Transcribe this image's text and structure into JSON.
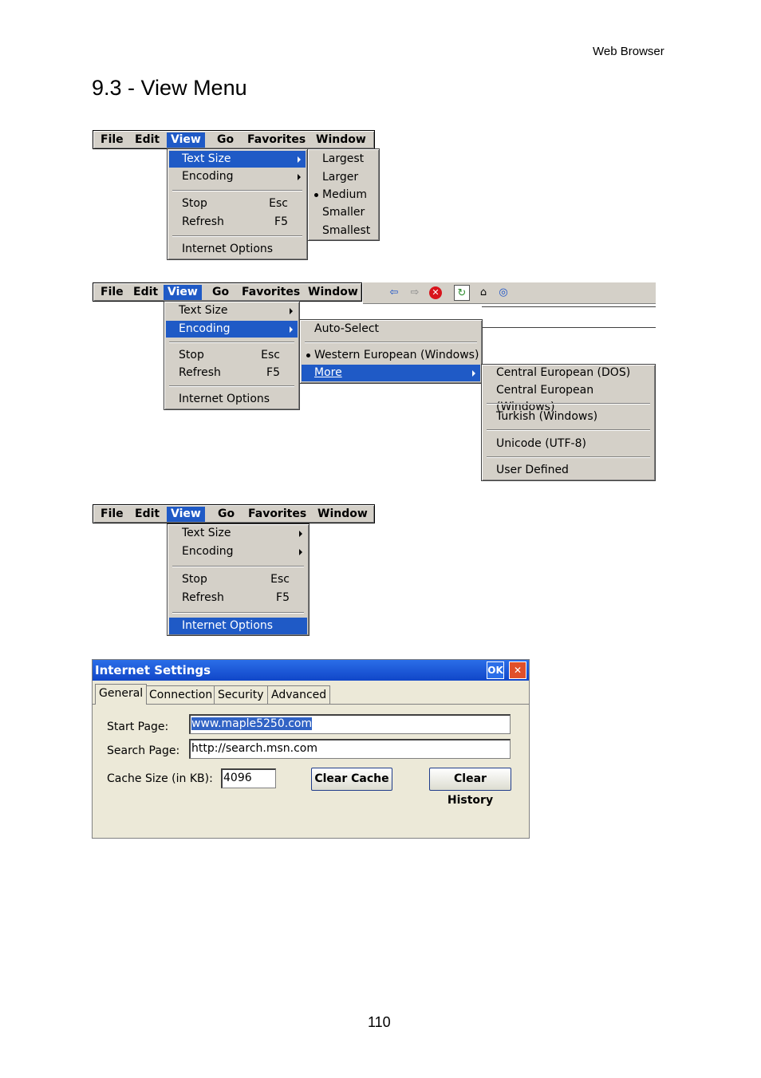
{
  "header": {
    "section": "Web Browser",
    "title": "9.3 - View Menu",
    "page_number": "110"
  },
  "menubar": [
    "File",
    "Edit",
    "View",
    "Go",
    "Favorites",
    "Window"
  ],
  "view_menu": {
    "text_size": "Text Size",
    "encoding": "Encoding",
    "stop": "Stop",
    "stop_key": "Esc",
    "refresh": "Refresh",
    "refresh_key": "F5",
    "internet_options": "Internet Options"
  },
  "text_size_submenu": [
    "Largest",
    "Larger",
    "Medium",
    "Smaller",
    "Smallest"
  ],
  "encoding_submenu": {
    "auto": "Auto-Select",
    "western": "Western European (Windows)",
    "more": "More"
  },
  "more_submenu": [
    "Central European (DOS)",
    "Central European (Windows)",
    "Turkish (Windows)",
    "Unicode (UTF-8)",
    "User Defined"
  ],
  "dialog": {
    "title": "Internet Settings",
    "ok": "OK",
    "close": "✕",
    "tabs": [
      "General",
      "Connection",
      "Security",
      "Advanced"
    ],
    "start_page_label": "Start Page:",
    "start_page_value": "www.maple5250.com",
    "search_page_label": "Search Page:",
    "search_page_value": "http://search.msn.com",
    "cache_label": "Cache Size (in KB):",
    "cache_value": "4096",
    "clear_cache": "Clear Cache",
    "clear_history": "Clear History"
  },
  "colors": {
    "highlight": "#1f5ac6",
    "menu_bg": "#d4d0c8",
    "dialog_bg": "#ece9d8"
  },
  "icons": [
    "back-arrow-icon",
    "forward-arrow-icon",
    "stop-icon",
    "refresh-icon",
    "home-icon",
    "search-icon"
  ]
}
